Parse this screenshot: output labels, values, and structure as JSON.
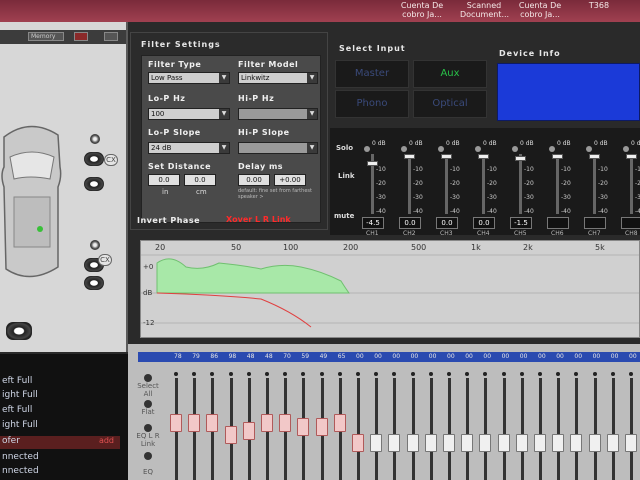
{
  "taskbar": {
    "items": [
      {
        "label": "Cuenta De\ncobro Ja..."
      },
      {
        "label": "Scanned\nDocument..."
      },
      {
        "label": "Cuenta De\ncobro Ja..."
      },
      {
        "label": "T368"
      }
    ]
  },
  "left_panel": {
    "top_buttons": [
      "Memory",
      ""
    ],
    "cx_labels": [
      "CX",
      "CX"
    ]
  },
  "channel_list": {
    "rows": [
      {
        "label": "eft Full",
        "selected": false
      },
      {
        "label": "ight Full",
        "selected": false
      },
      {
        "label": "eft Full",
        "selected": false
      },
      {
        "label": "ight Full",
        "selected": false
      },
      {
        "label": "ofer",
        "selected": true,
        "badge": "add"
      },
      {
        "label": "nnected",
        "selected": false
      },
      {
        "label": "nnected",
        "selected": false
      }
    ]
  },
  "filter_settings": {
    "title": "Filter Settings",
    "filter_type_label": "Filter Type",
    "filter_type_value": "Low Pass",
    "filter_model_label": "Filter Model",
    "filter_model_value": "Linkwitz",
    "lop_hz_label": "Lo-P  Hz",
    "lop_hz_value": "100",
    "hip_hz_label": "Hi-P  Hz",
    "hip_hz_value": "",
    "lop_slope_label": "Lo-P Slope",
    "lop_slope_value": "24 dB",
    "hip_slope_label": "Hi-P Slope",
    "hip_slope_value": "",
    "set_distance_label": "Set Distance",
    "distance_in_value": "0.0",
    "distance_cm_value": "0.0",
    "distance_in_unit": "in",
    "distance_cm_unit": "cm",
    "delay_label": "Delay  ms",
    "delay_value_1": "0.00",
    "delay_value_2": "+0.00",
    "delay_note": "default: fine set from farthest speaker >",
    "invert_phase_label": "Invert Phase",
    "xover_link_label": "Xover L R Link"
  },
  "select_input": {
    "title": "Select Input",
    "sources": [
      {
        "label": "Master",
        "active": false
      },
      {
        "label": "Aux",
        "active": true
      },
      {
        "label": "Phono",
        "active": false
      },
      {
        "label": "Optical",
        "active": false
      }
    ]
  },
  "device_info": {
    "title": "Device Info"
  },
  "mixer": {
    "solo_label": "Solo",
    "link_label": "Link",
    "mute_label": "mute",
    "scale": [
      "0 dB",
      "-10",
      "-20",
      "-30",
      "-40"
    ],
    "channels": [
      {
        "name": "CH1",
        "value": "-4.5",
        "level": 0.12
      },
      {
        "name": "CH2",
        "value": "0.0",
        "level": 0.0
      },
      {
        "name": "CH3",
        "value": "0.0",
        "level": 0.0
      },
      {
        "name": "CH4",
        "value": "0.0",
        "level": 0.0
      },
      {
        "name": "CH5",
        "value": "-1.5",
        "level": 0.04
      },
      {
        "name": "CH6",
        "value": "",
        "level": 0.0
      },
      {
        "name": "CH7",
        "value": "",
        "level": 0.0
      },
      {
        "name": "CH8",
        "value": "",
        "level": 0.0
      }
    ]
  },
  "graph": {
    "x_ticks": [
      "20",
      "50",
      "100",
      "200",
      "500",
      "1k",
      "2k",
      "5k"
    ],
    "y_ticks": [
      "+0",
      "dB",
      "-12"
    ]
  },
  "eq": {
    "freq_labels": [
      "78",
      "79",
      "86",
      "98",
      "48",
      "48",
      "70",
      "59",
      "49",
      "65",
      "00",
      "00",
      "00",
      "00",
      "00",
      "00",
      "00",
      "00",
      "00",
      "00",
      "00",
      "00",
      "00",
      "00",
      "00",
      "00",
      "00"
    ],
    "side_labels": [
      "Select All",
      "Flat",
      "EQ L R Link",
      "EQ"
    ],
    "handle_levels": [
      0.55,
      0.55,
      0.55,
      0.4,
      0.45,
      0.55,
      0.55,
      0.5,
      0.5,
      0.55,
      0.3,
      0.3,
      0.3,
      0.3,
      0.3,
      0.3,
      0.3,
      0.3,
      0.3,
      0.3,
      0.3,
      0.3,
      0.3,
      0.3,
      0.3,
      0.3,
      0.3
    ],
    "active_count": 11
  }
}
